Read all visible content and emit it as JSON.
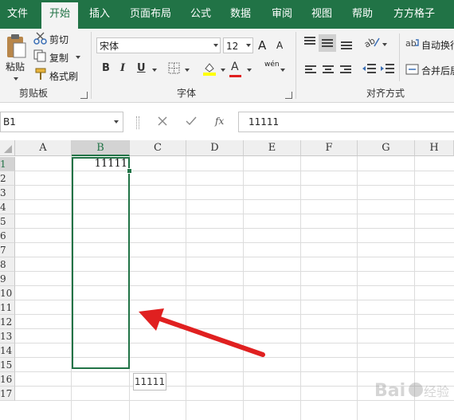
{
  "tabs": [
    {
      "label": "文件",
      "active": false
    },
    {
      "label": "开始",
      "active": true
    },
    {
      "label": "插入",
      "active": false
    },
    {
      "label": "页面布局",
      "active": false
    },
    {
      "label": "公式",
      "active": false
    },
    {
      "label": "数据",
      "active": false
    },
    {
      "label": "审阅",
      "active": false
    },
    {
      "label": "视图",
      "active": false
    },
    {
      "label": "帮助",
      "active": false
    },
    {
      "label": "方方格子",
      "active": false
    }
  ],
  "clipboard": {
    "paste": "粘贴",
    "cut": "剪切",
    "copy": "复制",
    "format_painter": "格式刷",
    "group": "剪贴板"
  },
  "font": {
    "name": "宋体",
    "size": "12",
    "group": "字体",
    "grow": "A",
    "shrink": "A",
    "bold": "B",
    "italic": "I",
    "underline": "U",
    "font_color": "A",
    "phonetic": "wén"
  },
  "alignment": {
    "wrap": "自动换行",
    "merge": "合并后居中",
    "group": "对齐方式"
  },
  "formula_bar": {
    "name_box": "B1",
    "fx": "fx",
    "value": "11111"
  },
  "columns": [
    "A",
    "B",
    "C",
    "D",
    "E",
    "F",
    "G",
    "H"
  ],
  "rows": [
    "1",
    "2",
    "3",
    "4",
    "5",
    "6",
    "7",
    "8",
    "9",
    "10",
    "11",
    "12",
    "13",
    "14",
    "15",
    "16",
    "17"
  ],
  "selected_column": "B",
  "selected_row": "1",
  "cell_b1": "11111",
  "tooltip": "11111",
  "colors": {
    "excel_green": "#217346",
    "arrow_red": "#e02020"
  }
}
